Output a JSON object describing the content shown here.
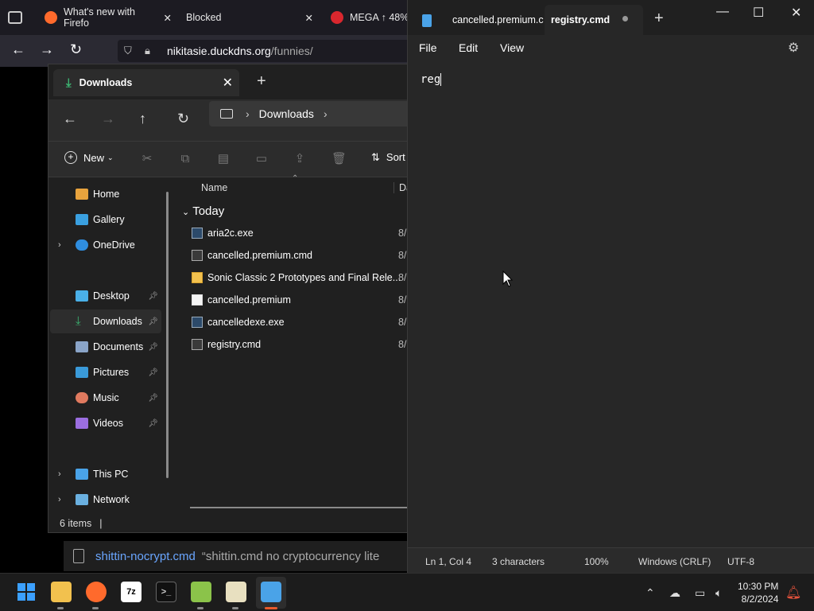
{
  "firefox": {
    "tabs": [
      {
        "label": "What's new with Firefo",
        "close": "✕"
      },
      {
        "label": "Blocked",
        "close": "✕"
      },
      {
        "label": "MEGA ↑ 48%"
      }
    ],
    "url": {
      "host": "nikitasie.duckdns.org",
      "path": "/funnies/"
    },
    "status_link": {
      "name": "shittin-nocrypt.cmd",
      "quote": "“shittin.cmd no cryptocurrency lite"
    }
  },
  "explorer": {
    "tab_title": "Downloads",
    "breadcrumb": {
      "current": "Downloads"
    },
    "toolbar": {
      "new_label": "New",
      "sort_label": "Sort"
    },
    "columns": {
      "name": "Name",
      "date": "Da"
    },
    "group": "Today",
    "files": [
      {
        "name": "aria2c.exe",
        "date": "8/",
        "type": "exe"
      },
      {
        "name": "cancelled.premium.cmd",
        "date": "8/",
        "type": "cmd"
      },
      {
        "name": "Sonic Classic 2 Prototypes and Final Rele...",
        "date": "8/",
        "type": "folder"
      },
      {
        "name": "cancelled.premium",
        "date": "8/",
        "type": "file"
      },
      {
        "name": "cancelledexe.exe",
        "date": "8/",
        "type": "exe"
      },
      {
        "name": "registry.cmd",
        "date": "8/",
        "type": "cmd"
      }
    ],
    "sidebar": [
      {
        "label": "Home",
        "color": "#e8a33d"
      },
      {
        "label": "Gallery",
        "color": "#3aa0e0"
      },
      {
        "label": "OneDrive",
        "color": "#2f8ee0"
      },
      {
        "label": "Desktop",
        "color": "#4ab0e8"
      },
      {
        "label": "Downloads",
        "color": "#3cb371"
      },
      {
        "label": "Documents",
        "color": "#8aa4c8"
      },
      {
        "label": "Pictures",
        "color": "#3a9ad9"
      },
      {
        "label": "Music",
        "color": "#e07a5f"
      },
      {
        "label": "Videos",
        "color": "#9b6ee0"
      },
      {
        "label": "This PC",
        "color": "#4aa3e8"
      },
      {
        "label": "Network",
        "color": "#6ab0e0"
      }
    ],
    "status": "6 items"
  },
  "notepad": {
    "tabs": [
      {
        "label": "cancelled.premium.c"
      },
      {
        "label": "registry.cmd"
      }
    ],
    "menu": {
      "file": "File",
      "edit": "Edit",
      "view": "View"
    },
    "content": "reg",
    "status": {
      "position": "Ln 1, Col 4",
      "characters": "3 characters",
      "zoom": "100%",
      "line_ending": "Windows (CRLF)",
      "encoding": "UTF-8"
    }
  },
  "taskbar": {
    "time": "10:30 PM",
    "date": "8/2/2024",
    "apps": [
      {
        "name": "start-button",
        "glyph": "⊞",
        "color": "#3ba0ff"
      },
      {
        "name": "file-explorer",
        "glyph": "",
        "color": "#f2c14e"
      },
      {
        "name": "firefox",
        "glyph": "",
        "color": "#ff6a2c"
      },
      {
        "name": "7zip",
        "glyph": "7z",
        "color": "#ffffff"
      },
      {
        "name": "terminal",
        "glyph": ">_",
        "color": "#cccccc"
      },
      {
        "name": "notepad-plus",
        "glyph": "",
        "color": "#8bc34a"
      },
      {
        "name": "archive",
        "glyph": "",
        "color": "#e8e0c0"
      },
      {
        "name": "notepad",
        "glyph": "",
        "color": "#4aa3e8"
      }
    ]
  }
}
